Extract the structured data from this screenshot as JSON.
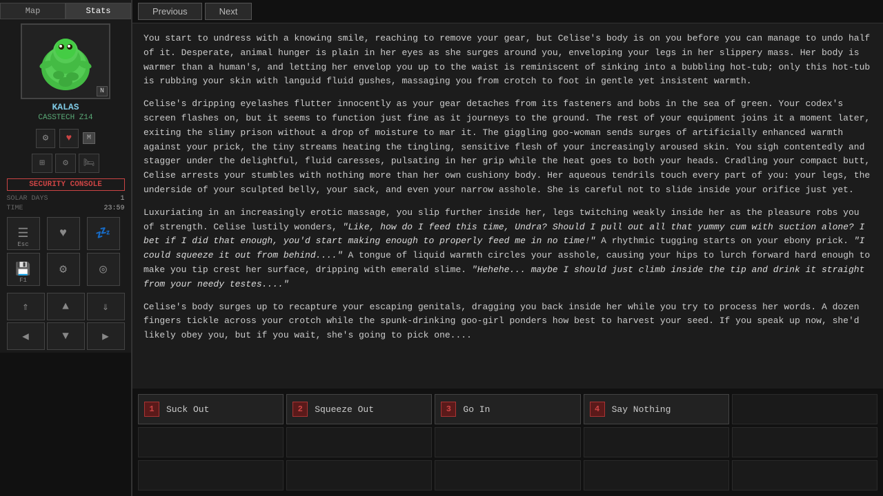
{
  "sidebar": {
    "map_label": "Map",
    "stats_label": "Stats",
    "character_name": "KALAS",
    "character_subname": "CASSTECH Z14",
    "portrait_badge": "N",
    "m_badge": "M",
    "security_console": "SECURITY CONSOLE",
    "solar_days_label": "SOLAR DAYS",
    "solar_days_value": "1",
    "time_label": "TIME",
    "time_value": "23:59",
    "esc_label": "Esc",
    "f1_label": "F1"
  },
  "nav": {
    "previous_label": "Previous",
    "next_label": "Next"
  },
  "content": {
    "paragraph1": "You start to undress with a knowing smile, reaching to remove your gear, but Celise's body is on you before you can manage to undo half of it. Desperate, animal hunger is plain in her eyes as she surges around you, enveloping your legs in her slippery mass. Her body is warmer than a human's, and letting her envelop you up to the waist is reminiscent of sinking into a bubbling hot-tub; only this hot-tub is rubbing your skin with languid fluid gushes, massaging you from crotch to foot in gentle yet insistent warmth.",
    "paragraph2": "Celise's dripping eyelashes flutter innocently as your gear detaches from its fasteners and bobs in the sea of green. Your codex's screen flashes on, but it seems to function just fine as it journeys to the ground. The rest of your equipment joins it a moment later, exiting the slimy prison without a drop of moisture to mar it. The giggling goo-woman sends surges of artificially enhanced warmth against your prick, the tiny streams heating the tingling, sensitive flesh of your increasingly aroused skin. You sigh contentedly and stagger under the delightful, fluid caresses, pulsating in her grip while the heat goes to both your heads. Cradling your compact butt, Celise arrests your stumbles with nothing more than her own cushiony body. Her aqueous tendrils touch every part of you: your legs, the underside of your sculpted belly, your sack, and even your narrow asshole. She is careful not to slide inside your orifice just yet.",
    "paragraph3_prefix": "Luxuriating in an increasingly erotic massage, you slip further inside her, legs twitching weakly inside her as the pleasure robs you of strength. Celise lustily wonders, ",
    "paragraph3_quote1": "\"Like, how do I feed this time, Undra? Should I pull out all that yummy cum with suction alone? I bet if I did that enough, you'd start making enough to properly feed me in no time!\"",
    "paragraph3_mid": " A rhythmic tugging starts on your ebony prick. ",
    "paragraph3_quote2": "\"I could squeeze it out from behind....\"",
    "paragraph3_mid2": " A tongue of liquid warmth circles your asshole, causing your hips to lurch forward hard enough to make you tip crest her surface, dripping with emerald slime. ",
    "paragraph3_quote3": "\"Hehehe... maybe I should just climb inside the tip and drink it straight from your needy testes....\"",
    "paragraph4": "Celise's body surges up to recapture your escaping genitals, dragging you back inside her while you try to process her words. A dozen fingers tickle across your crotch while the spunk-drinking goo-girl ponders how best to harvest your seed. If you speak up now, she'd likely obey you, but if you wait, she's going to pick one...."
  },
  "choices": [
    {
      "num": "1",
      "label": "Suck Out"
    },
    {
      "num": "2",
      "label": "Squeeze Out"
    },
    {
      "num": "3",
      "label": "Go In"
    },
    {
      "num": "4",
      "label": "Say Nothing"
    },
    {
      "num": "",
      "label": ""
    },
    {
      "num": "",
      "label": ""
    },
    {
      "num": "",
      "label": ""
    },
    {
      "num": "",
      "label": ""
    },
    {
      "num": "",
      "label": ""
    },
    {
      "num": "",
      "label": ""
    },
    {
      "num": "",
      "label": ""
    },
    {
      "num": "",
      "label": ""
    },
    {
      "num": "",
      "label": ""
    },
    {
      "num": "",
      "label": ""
    },
    {
      "num": "",
      "label": ""
    }
  ]
}
